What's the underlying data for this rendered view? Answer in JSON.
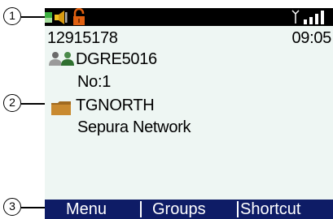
{
  "callouts": {
    "one": "1",
    "two": "2",
    "three": "3"
  },
  "status": {
    "icons": [
      "battery-indicator-icon",
      "speaker-icon",
      "lock-icon",
      "antenna-icon",
      "signal-bars-icon"
    ],
    "colors": {
      "background": "#000000",
      "speaker": "#f0c020",
      "lock": "#e06010",
      "battery": "#3cb040"
    }
  },
  "header": {
    "number": "12915178",
    "time": "09:05"
  },
  "talkgroup": {
    "name": "DGRE5016",
    "number": "No:1",
    "icon": "group-icon"
  },
  "folder": {
    "name": "TGNORTH",
    "network": "Sepura Network",
    "icon": "folder-icon"
  },
  "softkeys": {
    "menu": "Menu",
    "groups": "Groups",
    "shortcut": "Shortcut",
    "bar_color": "#0e1c66"
  },
  "screen": {
    "background": "#eef6f3"
  }
}
